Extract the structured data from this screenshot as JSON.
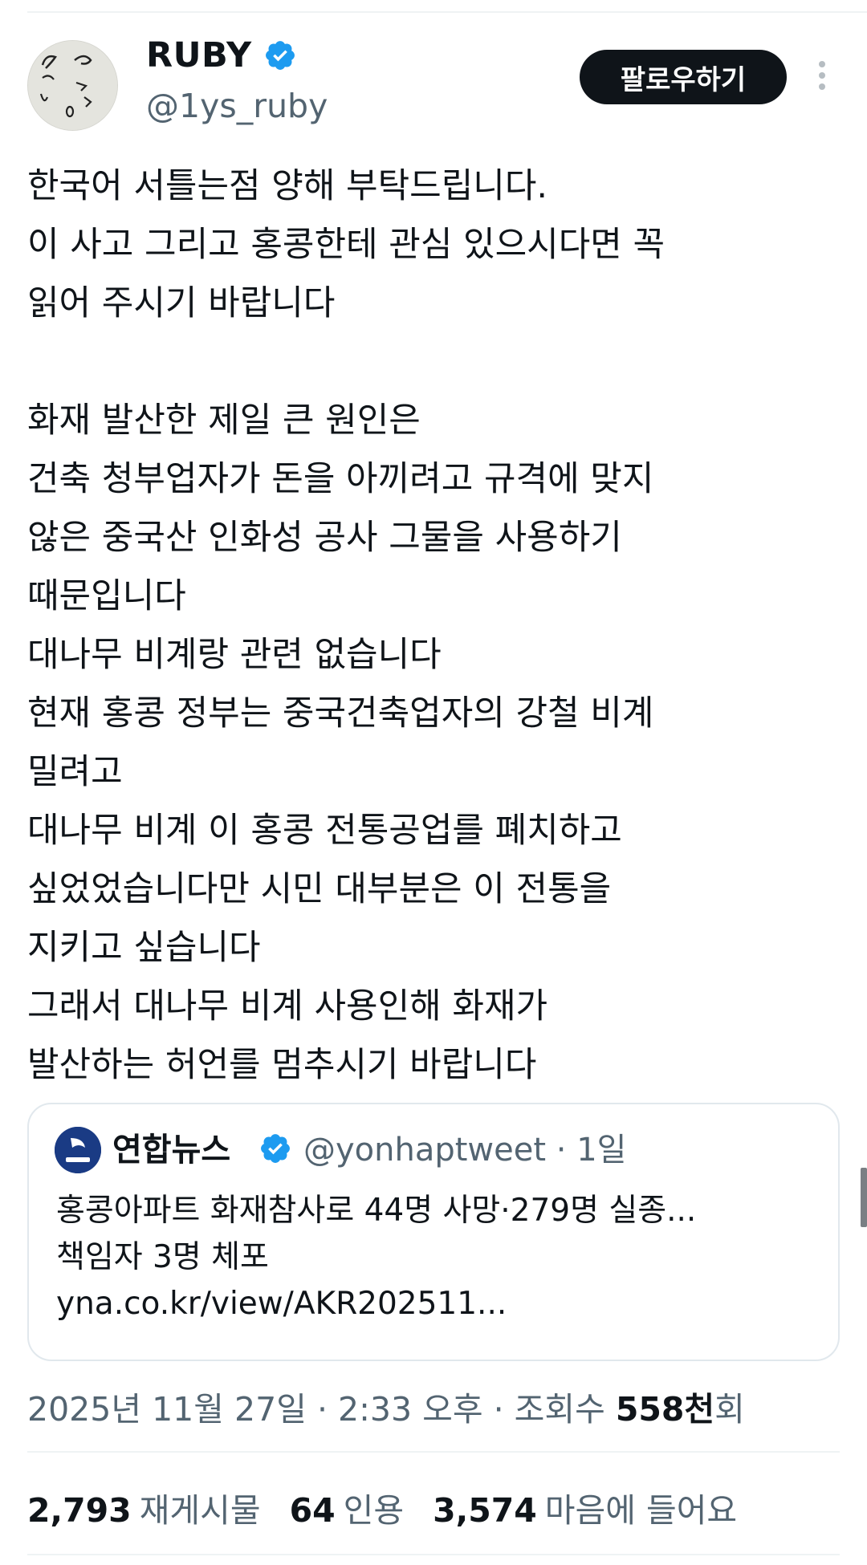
{
  "header": {
    "display_name": "RUBY",
    "handle": "@1ys_ruby",
    "follow_label": "팔로우하기"
  },
  "tweet": {
    "text": "한국어 서틀는점 양해 부탁드립니다.\n이 사고 그리고 홍콩한테 관심 있으시다면 꼭\n읽어 주시기 바랍니다\n\n화재 발산한 제일 큰 원인은\n건축 청부업자가 돈을 아끼려고 규격에 맞지\n않은 중국산 인화성 공사 그물을 사용하기\n때문입니다\n대나무 비계랑 관련 없습니다\n현재 홍콩 정부는 중국건축업자의 강철 비계\n밀려고\n대나무 비계 이 홍콩 전통공업를 폐치하고\n싶었었습니다만 시민 대부분은 이 전통을\n지키고 싶습니다\n그래서 대나무 비계 사용인해 화재가\n발산하는 허언를 멈추시기 바랍니다"
  },
  "quote": {
    "name": "연합뉴스",
    "handle": "@yonhaptweet · 1일",
    "text": "홍콩아파트 화재참사로 44명 사망·279명 실종...\n책임자 3명 체포\nyna.co.kr/view/AKR202511..."
  },
  "meta": {
    "date": "2025년 11월 27일 · 2:33 오후 · 조회수 ",
    "views": "558천",
    "views_suffix": "회"
  },
  "stats": {
    "retweets": "2,793",
    "retweets_label": "재게시물",
    "quotes": "64",
    "quotes_label": "인용",
    "likes": "3,574",
    "likes_label": "마음에 들어요"
  },
  "colors": {
    "verified": "#1d9bf0",
    "text_primary": "#0f1419",
    "text_secondary": "#536471",
    "follow_bg": "#0f1419"
  },
  "icons": {
    "verified": "verified-badge-icon",
    "more": "more-vertical-icon"
  }
}
